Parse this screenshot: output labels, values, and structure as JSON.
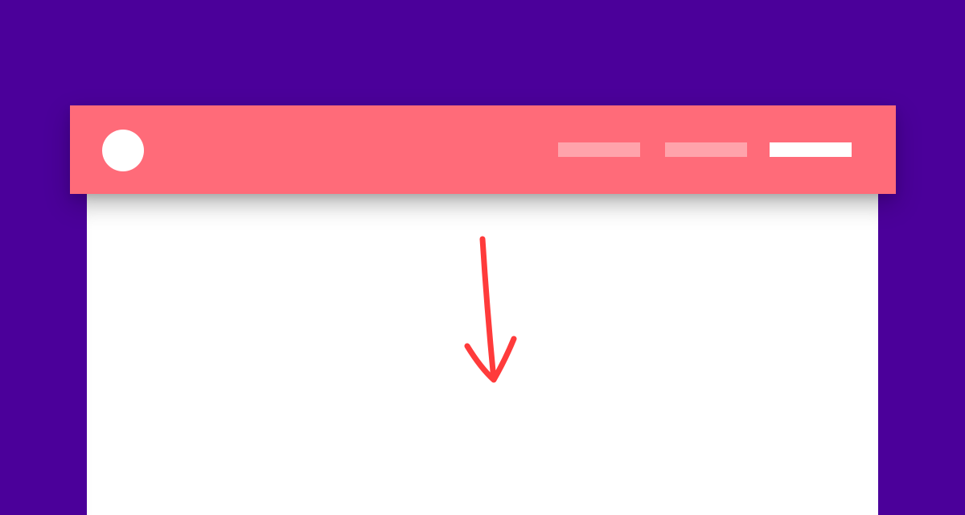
{
  "colors": {
    "background": "#4B009A",
    "navbar": "#FF6B79",
    "page": "#FFFFFF",
    "logo": "#FFFFFF",
    "nav_link_inactive": "#FFA3AB",
    "nav_link_active": "#FFFFFF",
    "annotation_arrow": "#FF3B3B"
  },
  "navbar": {
    "links": [
      {
        "active": false
      },
      {
        "active": false
      },
      {
        "active": true
      }
    ]
  },
  "annotation": {
    "icon": "arrow-down-icon",
    "meaning": "scroll-down"
  }
}
